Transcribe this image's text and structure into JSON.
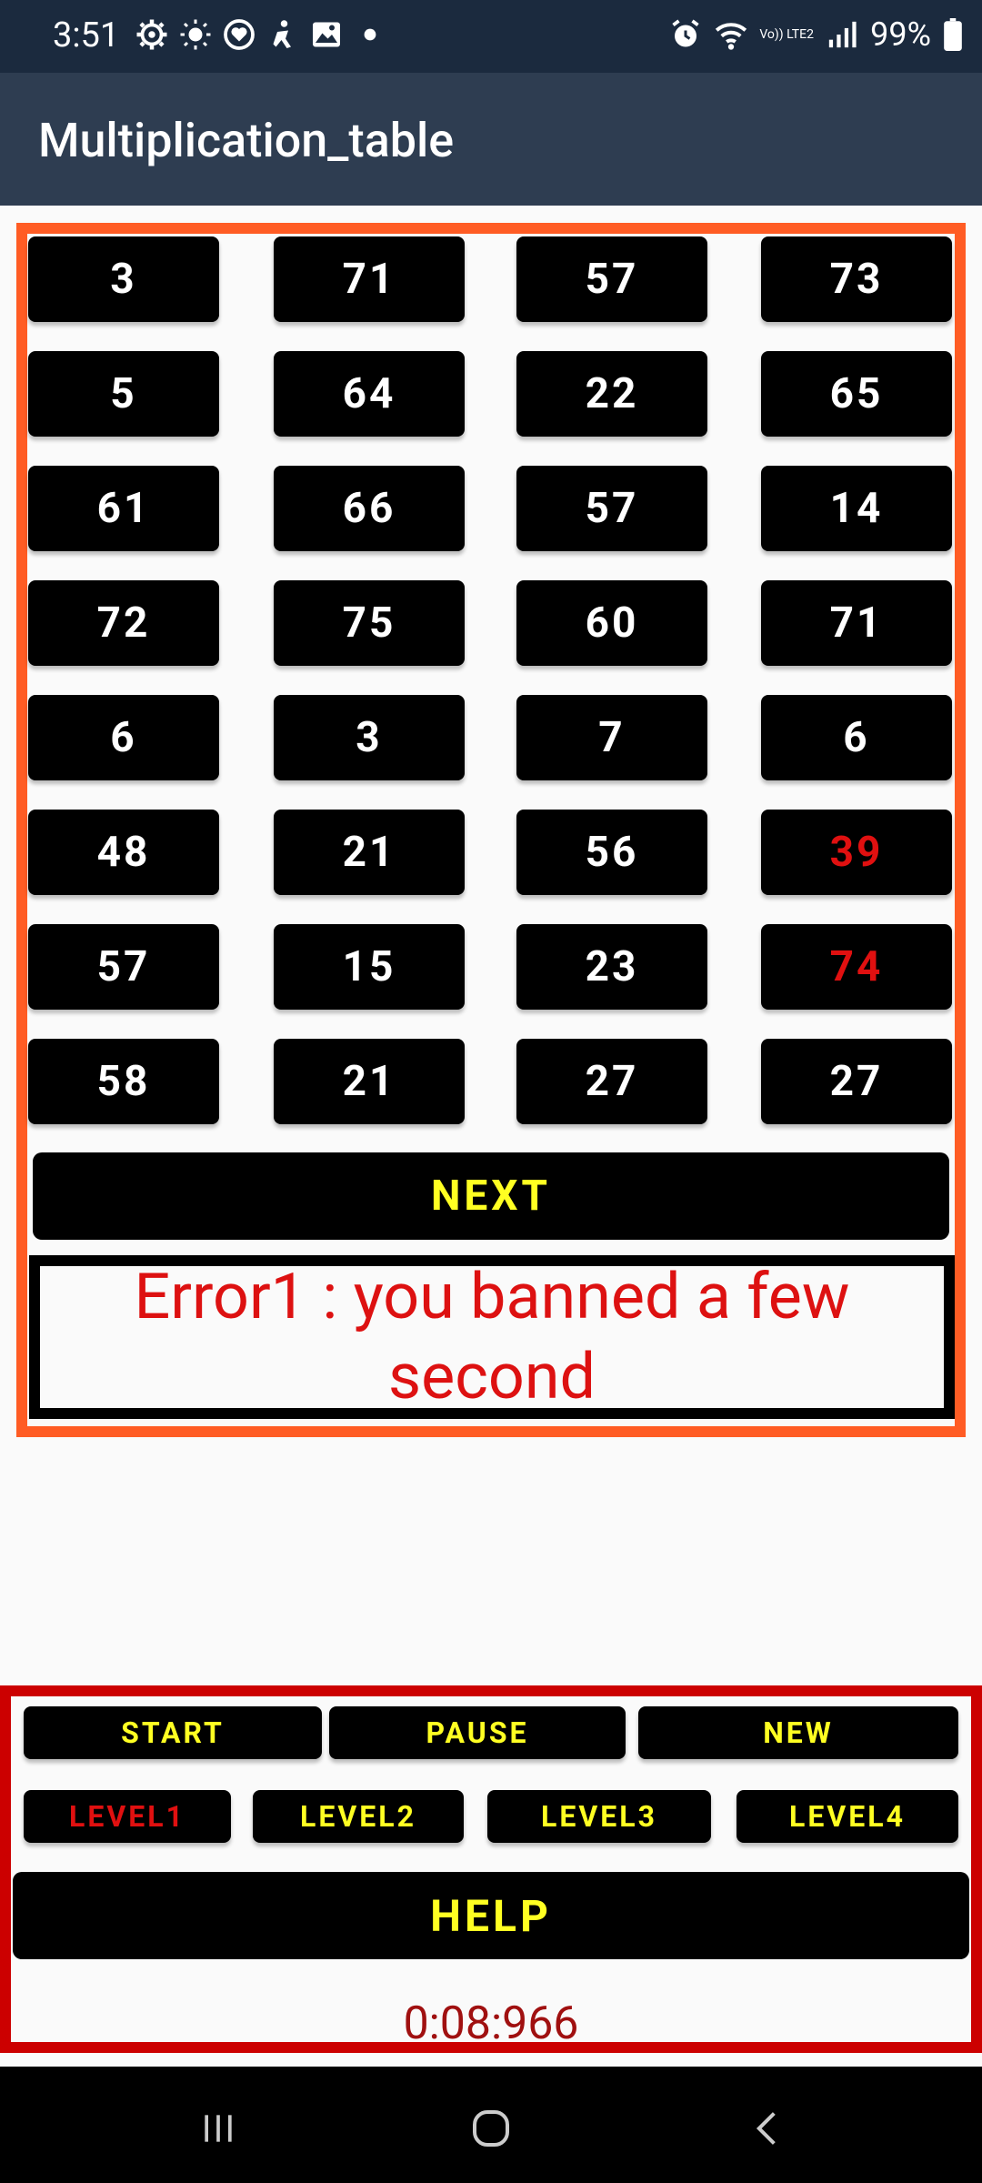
{
  "status_bar": {
    "time": "3:51",
    "battery": "99%",
    "icons_left": [
      "gear-icon",
      "brightness-icon",
      "heart-app-icon",
      "accessibility-icon",
      "image-icon",
      "dot-icon"
    ],
    "icons_right": [
      "alarm-icon",
      "wifi-icon",
      "volte-icon",
      "signal-icon",
      "battery-icon"
    ],
    "volte_label": "Vo)) LTE2"
  },
  "app_bar": {
    "title": "Multiplication_table"
  },
  "grid": {
    "rows": [
      [
        "3",
        "71",
        "57",
        "73"
      ],
      [
        "5",
        "64",
        "22",
        "65"
      ],
      [
        "61",
        "66",
        "57",
        "14"
      ],
      [
        "72",
        "75",
        "60",
        "71"
      ],
      [
        "6",
        "3",
        "7",
        "6"
      ],
      [
        "48",
        "21",
        "56",
        "39"
      ],
      [
        "57",
        "15",
        "23",
        "74"
      ],
      [
        "58",
        "21",
        "27",
        "27"
      ]
    ],
    "highlighted": [
      [
        5,
        3
      ],
      [
        6,
        3
      ]
    ],
    "highlight_color": "#e01010"
  },
  "next_label": "NEXT",
  "message": "Error1 : you banned a few second",
  "controls": {
    "row1": [
      "START",
      "PAUSE",
      "NEW"
    ],
    "levels": [
      "LEVEL1",
      "LEVEL2",
      "LEVEL3",
      "LEVEL4"
    ],
    "active_level": "LEVEL1",
    "help_label": "HELP"
  },
  "timer": "0:08:966",
  "colors": {
    "grid_border": "#ff5c24",
    "control_border": "#cc0000",
    "button_text": "#ffff22",
    "error_text": "#dd1111"
  }
}
